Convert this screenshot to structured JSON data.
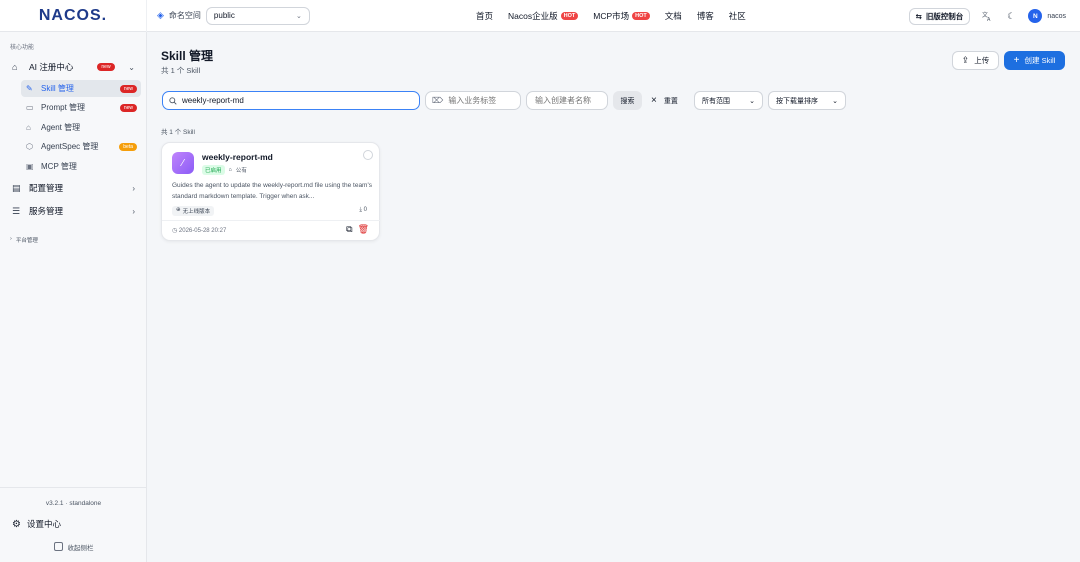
{
  "header": {
    "logo_text": "NACOS.",
    "namespace_label": "命名空间",
    "namespace_value": "public",
    "nav": [
      {
        "label": "首页",
        "hot": ""
      },
      {
        "label": "Nacos企业版",
        "hot": "HOT"
      },
      {
        "label": "MCP市场",
        "hot": "HOT"
      },
      {
        "label": "文档",
        "hot": ""
      },
      {
        "label": "博客",
        "hot": ""
      },
      {
        "label": "社区",
        "hot": ""
      }
    ],
    "old_console_label": "旧版控制台",
    "avatar_letter": "N",
    "username": "nacos"
  },
  "sidebar": {
    "section_label": "核心功能",
    "ai_group": {
      "label": "AI 注册中心",
      "badge": "new"
    },
    "ai_items": [
      {
        "label": "Skill 管理",
        "badge": "new"
      },
      {
        "label": "Prompt 管理",
        "badge": "new"
      },
      {
        "label": "Agent 管理",
        "badge": ""
      },
      {
        "label": "AgentSpec 管理",
        "badge": "beta"
      },
      {
        "label": "MCP 管理",
        "badge": ""
      }
    ],
    "config_group": "配置管理",
    "service_group": "服务管理",
    "platform_label": "平台管理",
    "version": "v3.2.1 · standalone",
    "settings_label": "设置中心",
    "collapse_label": "收起侧栏"
  },
  "main": {
    "title": "Skill 管理",
    "count_text": "共 1 个 Skill",
    "upload_label": "上传",
    "create_label": "创建 Skill",
    "search_value": "weekly-report-md",
    "tag_placeholder": "输入业务标签",
    "creator_placeholder": "输入创建者名称",
    "search_button": "搜索",
    "reset_button": "重置",
    "scope_select": "所有范围",
    "sort_select": "按下载量排序",
    "result_count": "共 1 个 Skill"
  },
  "card": {
    "name": "weekly-report-md",
    "status": "已启用",
    "visibility": "公有",
    "description": "Guides the agent to update the weekly-report.md file using the team's standard markdown template. Trigger when ask...",
    "online_tag": "无上线版本",
    "downloads": "0",
    "timestamp": "2026-05-28 20:27"
  },
  "colors": {
    "primary": "#1d6fe0",
    "hot": "#ef4444",
    "new_badge": "#dc2626",
    "beta_badge": "#f59e0b",
    "enabled_green": "#16a34a"
  }
}
